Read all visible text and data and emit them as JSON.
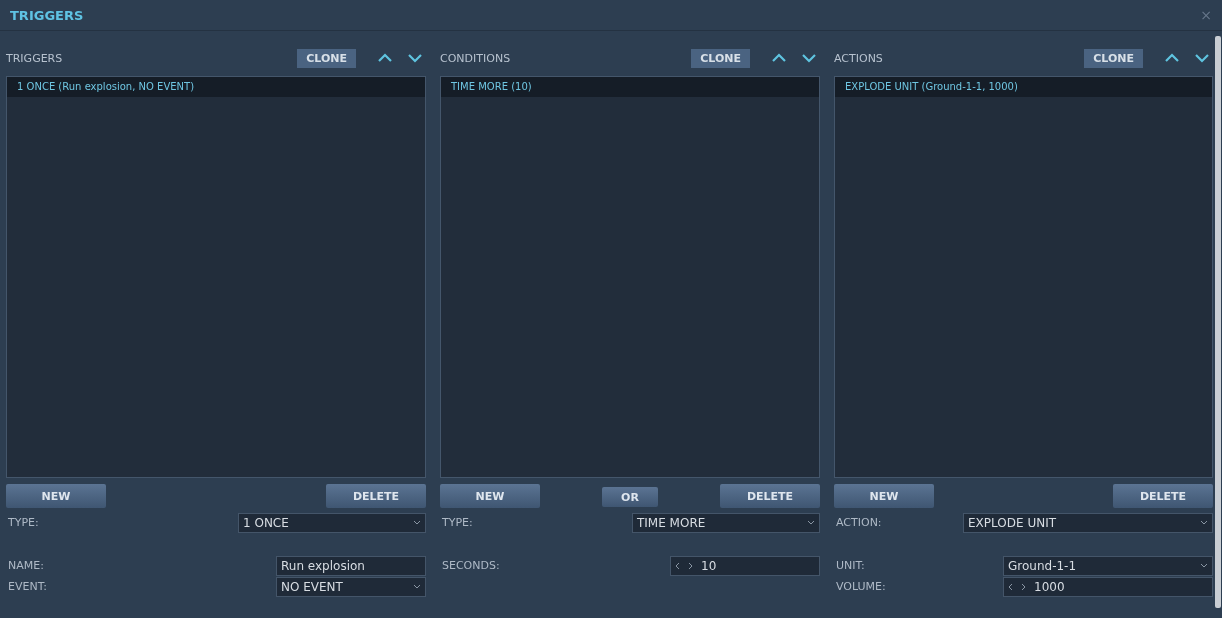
{
  "window": {
    "title": "TRIGGERS",
    "close": "×"
  },
  "panels": [
    {
      "title": "TRIGGERS",
      "clone": "CLONE",
      "items": [
        {
          "label": "1 ONCE (Run explosion, NO EVENT)",
          "selected": true
        }
      ],
      "buttons": [
        "NEW",
        "DELETE"
      ],
      "fields": [
        {
          "label": "TYPE:",
          "kind": "dropdown",
          "value": "1 ONCE"
        },
        {
          "label": "NAME:",
          "kind": "text",
          "value": "Run explosion"
        },
        {
          "label": "EVENT:",
          "kind": "dropdown",
          "value": "NO EVENT"
        }
      ]
    },
    {
      "title": "CONDITIONS",
      "clone": "CLONE",
      "items": [
        {
          "label": "TIME MORE (10)",
          "selected": true
        }
      ],
      "buttons": [
        "NEW",
        "OR",
        "DELETE"
      ],
      "fields": [
        {
          "label": "TYPE:",
          "kind": "dropdown",
          "value": "TIME MORE"
        },
        {
          "label": "SECONDS:",
          "kind": "spinner",
          "value": "10"
        }
      ]
    },
    {
      "title": "ACTIONS",
      "clone": "CLONE",
      "items": [
        {
          "label": "EXPLODE UNIT (Ground-1-1, 1000)",
          "selected": true
        }
      ],
      "buttons": [
        "NEW",
        "DELETE"
      ],
      "fields": [
        {
          "label": "ACTION:",
          "kind": "dropdown",
          "value": "EXPLODE UNIT"
        },
        {
          "label": "UNIT:",
          "kind": "dropdown",
          "value": "Ground-1-1"
        },
        {
          "label": "VOLUME:",
          "kind": "spinner",
          "value": "1000"
        }
      ]
    }
  ]
}
